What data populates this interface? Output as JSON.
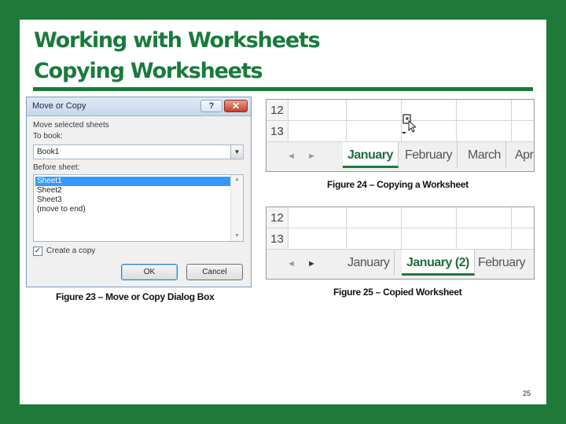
{
  "slide": {
    "title_line1": "Working with Worksheets",
    "title_line2": "Copying Worksheets",
    "page_number": "25",
    "accent_color": "#1f7a3a"
  },
  "dialog": {
    "title": "Move or Copy",
    "help_label": "?",
    "close_label": "✕",
    "move_label": "Move selected sheets",
    "to_book_label": "To book:",
    "to_book_value": "Book1",
    "before_sheet_label": "Before sheet:",
    "sheets": [
      "Sheet1",
      "Sheet2",
      "Sheet3",
      "(move to end)"
    ],
    "selected_sheet": "Sheet1",
    "create_copy_label": "Create a copy",
    "create_copy_checked": true,
    "ok_label": "OK",
    "cancel_label": "Cancel"
  },
  "captions": {
    "fig23": "Figure 23 – Move or Copy Dialog Box",
    "fig24": "Figure 24 – Copying a Worksheet",
    "fig25": "Figure 25 – Copied Worksheet"
  },
  "excel_a": {
    "rows": [
      "12",
      "13"
    ],
    "tabs": [
      "January",
      "February",
      "March",
      "Apr"
    ],
    "active_tab": "January",
    "nav_prev": "◄",
    "nav_next": "►",
    "cursor_icon": "copy-cursor-icon"
  },
  "excel_b": {
    "rows": [
      "12",
      "13"
    ],
    "tabs": [
      "January",
      "January (2)",
      "February"
    ],
    "active_tab": "January (2)",
    "nav_prev": "◄",
    "nav_next": "►"
  }
}
